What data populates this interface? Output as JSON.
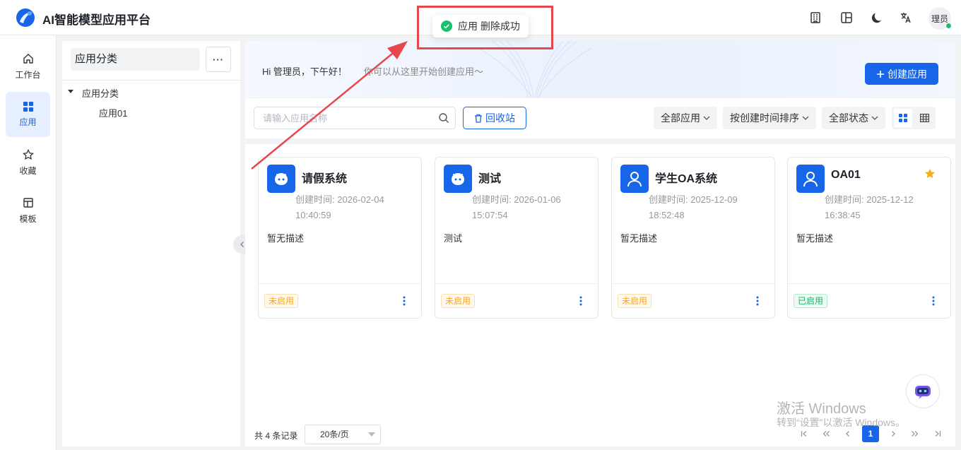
{
  "app": {
    "title": "AI智能模型应用平台"
  },
  "header": {
    "icons": [
      "building-icon",
      "layout-icon",
      "moon-icon",
      "translate-icon"
    ],
    "user_label": "理员"
  },
  "nav": {
    "items": [
      {
        "label": "工作台",
        "icon": "home-icon",
        "active": false
      },
      {
        "label": "应用",
        "icon": "apps-grid-icon",
        "active": true
      },
      {
        "label": "收藏",
        "icon": "star-icon",
        "active": false
      },
      {
        "label": "模板",
        "icon": "template-icon",
        "active": false
      }
    ]
  },
  "category": {
    "header": "应用分类",
    "more_label": "···",
    "tree_root": "应用分类",
    "tree_child": "应用01"
  },
  "banner": {
    "greeting": "Hi 管理员，下午好！",
    "subtitle": "你可以从这里开始创建应用～",
    "create_label": "创建应用"
  },
  "toolbar": {
    "search_placeholder": "请输入应用名称",
    "recycle_label": "回收站",
    "filter_app": "全部应用",
    "sort_label": "按创建时间排序",
    "filter_status": "全部状态"
  },
  "cards": [
    {
      "title": "请假系统",
      "time": "创建时间: 2026-02-04 10:40:59",
      "desc": "暂无描述",
      "status": "未启用",
      "enabled": false,
      "icon": "bot-icon",
      "starred": false
    },
    {
      "title": "测试",
      "time": "创建时间: 2026-01-06 15:07:54",
      "desc": "测试",
      "status": "未启用",
      "enabled": false,
      "icon": "bot-icon",
      "starred": false
    },
    {
      "title": "学生OA系统",
      "time": "创建时间: 2025-12-09 18:52:48",
      "desc": "暂无描述",
      "status": "未启用",
      "enabled": false,
      "icon": "user-icon",
      "starred": false
    },
    {
      "title": "OA01",
      "time": "创建时间: 2025-12-12 16:38:45",
      "desc": "暂无描述",
      "status": "已启用",
      "enabled": true,
      "icon": "user-icon",
      "starred": true
    }
  ],
  "pagination": {
    "total": "共 4 条记录",
    "page_size": "20条/页",
    "current_page": "1"
  },
  "toast": {
    "message": "应用 删除成功"
  },
  "watermark": {
    "line1": "激活 Windows",
    "line2": "转到“设置”以激活 Windows。"
  },
  "colors": {
    "primary": "#1765e8",
    "success": "#18c16c",
    "warning": "#f5a623",
    "annotation": "#e7474c"
  }
}
